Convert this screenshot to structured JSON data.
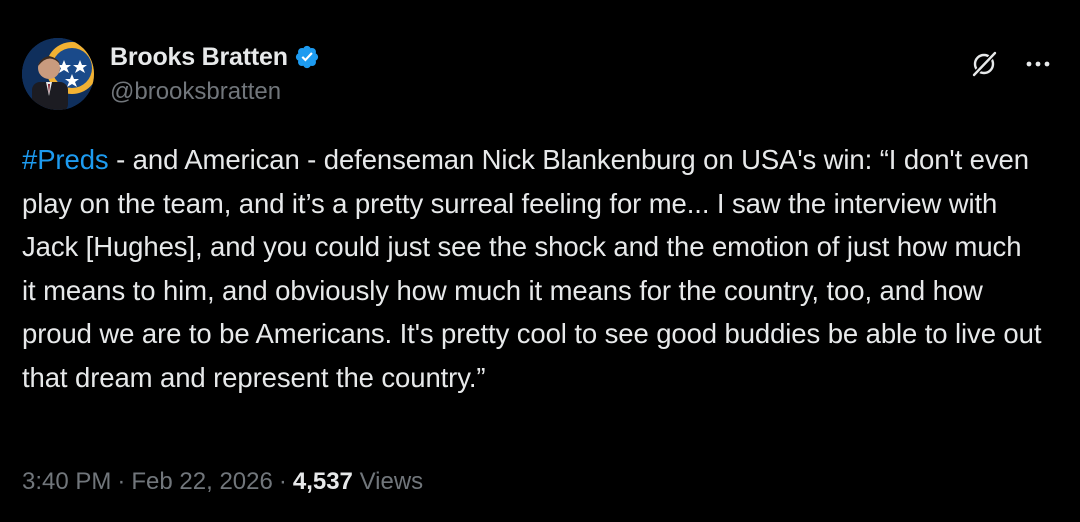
{
  "author": {
    "display_name": "Brooks Bratten",
    "handle": "@brooksbratten",
    "verified": true
  },
  "icons": {
    "verified": "verified-badge-icon",
    "grok": "grok-icon",
    "more": "more-horizontal-icon"
  },
  "tweet": {
    "hashtag": "#Preds",
    "text": " - and American - defenseman Nick Blankenburg on USA's win: “I don't even play on the team, and it’s a pretty surreal feeling for me... I saw the interview with Jack [Hughes], and you could just see the shock and the emotion of just how much it means to him, and obviously how much it means for the country, too, and how proud we are to be Americans. It's pretty cool to see good buddies be able to live out that dream and represent the country.”"
  },
  "meta": {
    "time": "3:40 PM",
    "separator": "·",
    "date": "Feb 22, 2026",
    "views_count": "4,537",
    "views_label": "Views"
  },
  "colors": {
    "background": "#000000",
    "text": "#e7e9ea",
    "muted": "#71767b",
    "accent": "#1d9bf0"
  }
}
